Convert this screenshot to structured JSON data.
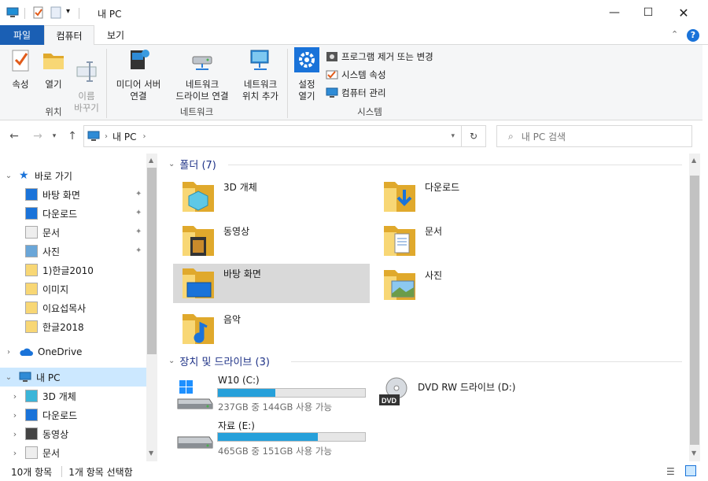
{
  "window": {
    "title": "내 PC"
  },
  "ribbon_tabs": {
    "file": "파일",
    "computer": "컴퓨터",
    "view": "보기"
  },
  "ribbon": {
    "properties": "속성",
    "open": "열기",
    "rename": "이름\n바꾸기",
    "media_server": "미디어 서버\n연결",
    "map_drive": "네트워크\n드라이브 연결",
    "add_location": "네트워크\n위치 추가",
    "settings": "설정\n열기",
    "uninstall": "프로그램 제거 또는 변경",
    "system_props": "시스템 속성",
    "manage": "컴퓨터 관리",
    "group_location": "위치",
    "group_network": "네트워크",
    "group_system": "시스템"
  },
  "address": {
    "crumb": "내 PC",
    "search_placeholder": "내 PC 검색"
  },
  "sidebar": {
    "quick": "바로 가기",
    "items": [
      {
        "label": "바탕 화면",
        "icon": "desktop-icon",
        "pinned": true
      },
      {
        "label": "다운로드",
        "icon": "download-icon",
        "pinned": true
      },
      {
        "label": "문서",
        "icon": "document-icon",
        "pinned": true
      },
      {
        "label": "사진",
        "icon": "picture-icon",
        "pinned": true
      },
      {
        "label": "1)한글2010",
        "icon": "folder-icon",
        "pinned": false
      },
      {
        "label": "이미지",
        "icon": "folder-icon",
        "pinned": false
      },
      {
        "label": "이요섭목사",
        "icon": "folder-icon",
        "pinned": false
      },
      {
        "label": "한글2018",
        "icon": "folder-icon",
        "pinned": false
      }
    ],
    "onedrive": "OneDrive",
    "thispc": "내 PC",
    "pc_items": [
      {
        "label": "3D 개체",
        "icon": "3d-objects-icon"
      },
      {
        "label": "다운로드",
        "icon": "download-icon"
      },
      {
        "label": "동영상",
        "icon": "video-icon"
      },
      {
        "label": "문서",
        "icon": "document-icon"
      }
    ]
  },
  "folders": {
    "header": "폴더 (7)",
    "items": [
      {
        "label": "3D 개체",
        "icon": "3d-objects-folder-icon"
      },
      {
        "label": "다운로드",
        "icon": "downloads-folder-icon"
      },
      {
        "label": "동영상",
        "icon": "videos-folder-icon"
      },
      {
        "label": "문서",
        "icon": "documents-folder-icon"
      },
      {
        "label": "바탕 화면",
        "icon": "desktop-folder-icon",
        "selected": true
      },
      {
        "label": "사진",
        "icon": "pictures-folder-icon"
      },
      {
        "label": "음악",
        "icon": "music-folder-icon"
      }
    ]
  },
  "drives": {
    "header": "장치 및 드라이브 (3)",
    "items": [
      {
        "label": "W10 (C:)",
        "free_text": "237GB 중 144GB 사용 가능",
        "used_fraction": 0.39,
        "icon": "windows-drive-icon"
      },
      {
        "label": "DVD RW 드라이브 (D:)",
        "icon": "dvd-drive-icon"
      },
      {
        "label": "자료 (E:)",
        "free_text": "465GB 중 151GB 사용 가능",
        "used_fraction": 0.68,
        "icon": "hard-drive-icon"
      }
    ]
  },
  "status": {
    "count": "10개 항목",
    "selected": "1개 항목 선택함"
  },
  "colors": {
    "accent": "#1a5fb4",
    "selection": "#d9d9d9",
    "bar_fill": "#26a0da",
    "folder": "#f8d775"
  }
}
